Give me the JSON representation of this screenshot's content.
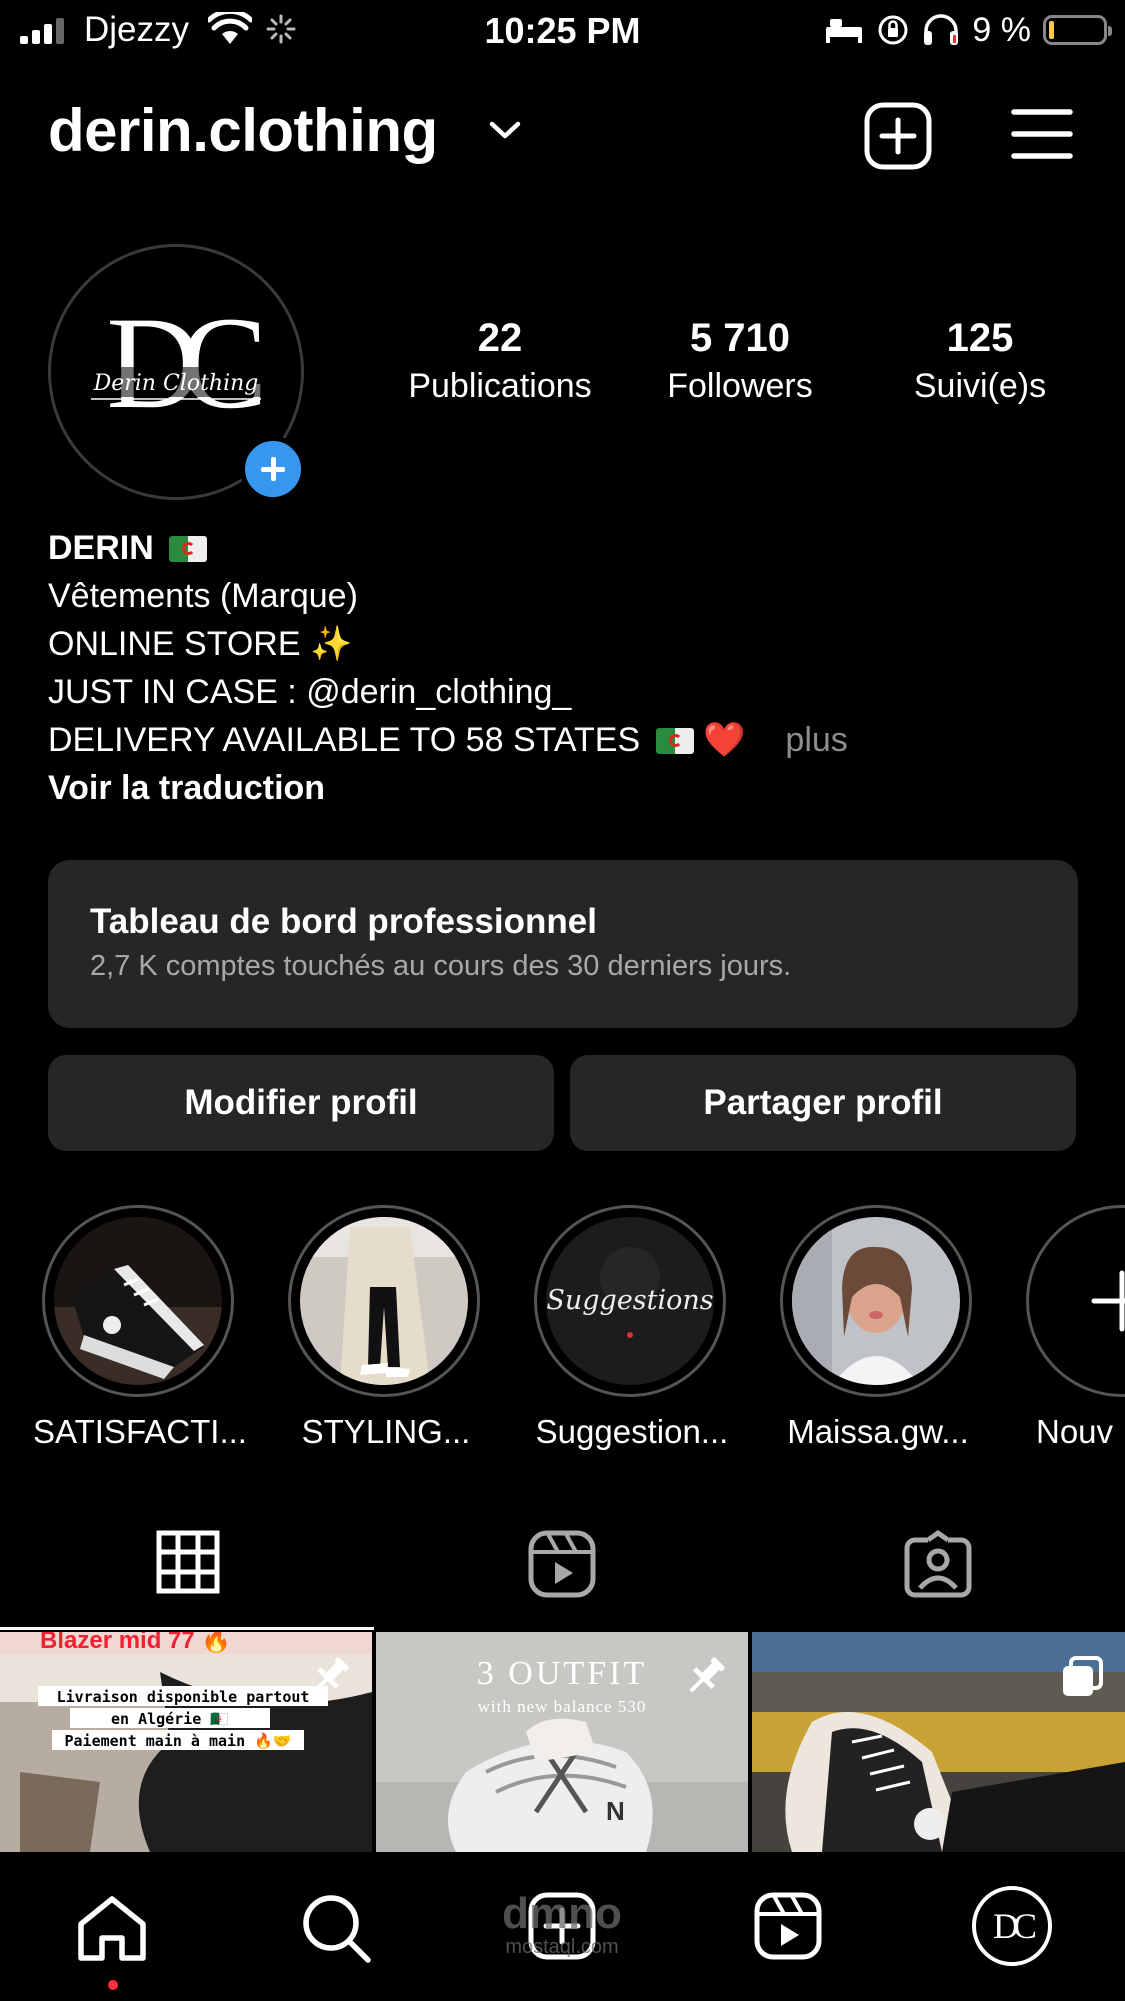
{
  "status_bar": {
    "carrier": "Djezzy",
    "time": "10:25 PM",
    "battery_text": "9 %",
    "battery_level": 0.09
  },
  "header": {
    "username": "derin.clothing"
  },
  "profile": {
    "avatar_monogram": "DC",
    "avatar_script": "Derin Clothing",
    "stats": [
      {
        "value": "22",
        "label": "Publications"
      },
      {
        "value": "5 710",
        "label": "Followers"
      },
      {
        "value": "125",
        "label": "Suivi(e)s"
      }
    ]
  },
  "bio": {
    "name": "DERIN",
    "category": "Vêtements (Marque)",
    "line1": "ONLINE STORE ✨",
    "line2": "JUST IN CASE : @derin_clothing_",
    "line3": "DELIVERY AVAILABLE TO 58 STATES",
    "heart": "❤️",
    "more": "plus",
    "translate": "Voir la traduction"
  },
  "dashboard": {
    "title": "Tableau de bord professionnel",
    "subtitle": "2,7 K comptes touchés au cours des 30 derniers jours."
  },
  "buttons": {
    "edit_profile": "Modifier profil",
    "share_profile": "Partager profil"
  },
  "highlights": [
    {
      "label": "SATISFACTI..."
    },
    {
      "label": "STYLING..."
    },
    {
      "label": "Suggestion...",
      "cover_text": "Suggestions"
    },
    {
      "label": "Maissa.gw..."
    },
    {
      "label": "Nouv"
    }
  ],
  "posts": [
    {
      "text_top": "Blazer mid 77 🔥",
      "text_lines": [
        "Livraison disponible partout",
        "en Algérie 🇩🇿",
        "Paiement main à main 🔥🤝"
      ],
      "pinned": true
    },
    {
      "title": "3 OUTFIT",
      "subtitle": "with new balance 530",
      "pinned": true
    },
    {
      "multiple": true
    }
  ],
  "watermark": {
    "line1": "dmno",
    "line2": "mostaql.com"
  },
  "colors": {
    "background": "#000000",
    "surface": "#262626",
    "accent_blue": "#3797f0",
    "notification_red": "#ff3040",
    "muted_text": "#a8a8a8"
  }
}
